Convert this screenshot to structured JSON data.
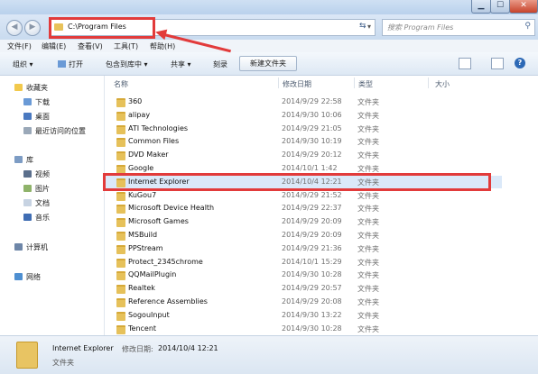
{
  "address": {
    "path": "C:\\Program Files"
  },
  "search": {
    "placeholder": "搜索 Program Files"
  },
  "menu": [
    "文件(F)",
    "编辑(E)",
    "查看(V)",
    "工具(T)",
    "帮助(H)"
  ],
  "toolbar": {
    "organize": "组织 ▾",
    "open": "打开",
    "include": "包含到库中 ▾",
    "share": "共享 ▾",
    "burn": "刻录",
    "new_folder": "新建文件夹"
  },
  "nav": {
    "favorites": "收藏夹",
    "downloads": "下载",
    "desktop": "桌面",
    "recent": "最近访问的位置",
    "libraries": "库",
    "videos": "视频",
    "pictures": "图片",
    "documents": "文档",
    "music": "音乐",
    "computer": "计算机",
    "network": "网络"
  },
  "columns": {
    "name": "名称",
    "date": "修改日期",
    "type": "类型",
    "size": "大小"
  },
  "files": [
    {
      "name": "360",
      "date": "2014/9/29 22:58",
      "type": "文件夹"
    },
    {
      "name": "alipay",
      "date": "2014/9/30 10:06",
      "type": "文件夹"
    },
    {
      "name": "ATI Technologies",
      "date": "2014/9/29 21:05",
      "type": "文件夹"
    },
    {
      "name": "Common Files",
      "date": "2014/9/30 10:19",
      "type": "文件夹"
    },
    {
      "name": "DVD Maker",
      "date": "2014/9/29 20:12",
      "type": "文件夹"
    },
    {
      "name": "Google",
      "date": "2014/10/1 1:42",
      "type": "文件夹"
    },
    {
      "name": "Internet Explorer",
      "date": "2014/10/4 12:21",
      "type": "文件夹"
    },
    {
      "name": "KuGou7",
      "date": "2014/9/29 21:52",
      "type": "文件夹"
    },
    {
      "name": "Microsoft Device Health",
      "date": "2014/9/29 22:37",
      "type": "文件夹"
    },
    {
      "name": "Microsoft Games",
      "date": "2014/9/29 20:09",
      "type": "文件夹"
    },
    {
      "name": "MSBuild",
      "date": "2014/9/29 20:09",
      "type": "文件夹"
    },
    {
      "name": "PPStream",
      "date": "2014/9/29 21:36",
      "type": "文件夹"
    },
    {
      "name": "Protect_2345chrome",
      "date": "2014/10/1 15:29",
      "type": "文件夹"
    },
    {
      "name": "QQMailPlugin",
      "date": "2014/9/30 10:28",
      "type": "文件夹"
    },
    {
      "name": "Realtek",
      "date": "2014/9/29 20:57",
      "type": "文件夹"
    },
    {
      "name": "Reference Assemblies",
      "date": "2014/9/29 20:08",
      "type": "文件夹"
    },
    {
      "name": "SogouInput",
      "date": "2014/9/30 13:22",
      "type": "文件夹"
    },
    {
      "name": "Tencent",
      "date": "2014/9/30 10:28",
      "type": "文件夹"
    }
  ],
  "status": {
    "name": "Internet Explorer",
    "date_label": "修改日期:",
    "date": "2014/10/4 12:21",
    "type": "文件夹"
  },
  "colors": {
    "highlight": "#e23b3b",
    "folder": "#e6c15a",
    "chrome": "#c9dbef"
  }
}
